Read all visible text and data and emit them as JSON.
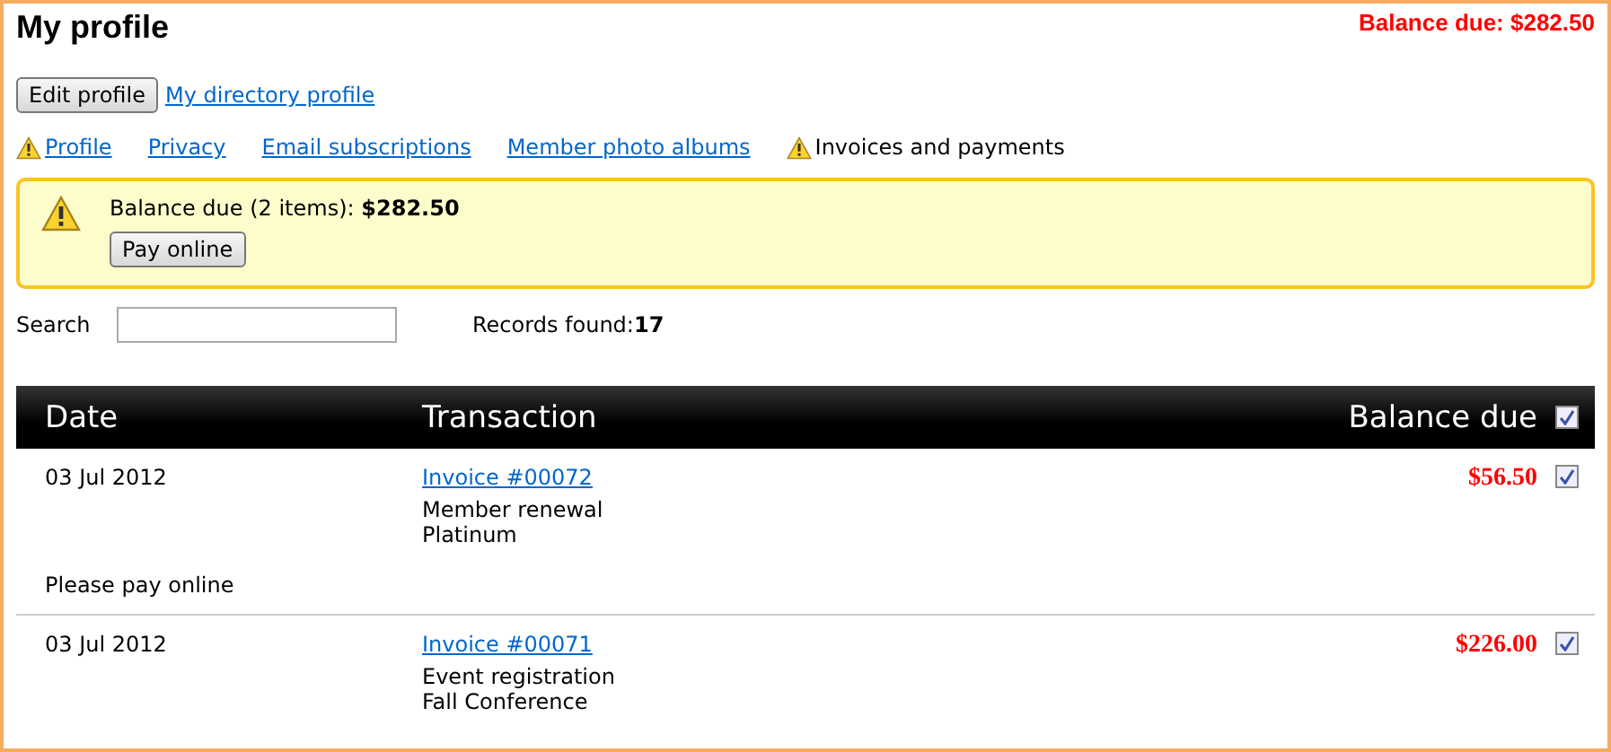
{
  "page": {
    "title": "My profile",
    "balance_summary": "Balance due: $282.50"
  },
  "actions": {
    "edit_button": "Edit profile",
    "directory_link": "My directory profile"
  },
  "tabs": [
    {
      "label": "Profile",
      "selected": false,
      "warning": true
    },
    {
      "label": "Privacy",
      "selected": false,
      "warning": false
    },
    {
      "label": "Email subscriptions",
      "selected": false,
      "warning": false
    },
    {
      "label": "Member photo albums",
      "selected": false,
      "warning": false
    },
    {
      "label": "Invoices and payments",
      "selected": true,
      "warning": true
    }
  ],
  "alert": {
    "text": "Balance due (2 items): **$282.50**",
    "button": "Pay online"
  },
  "search": {
    "label": "Search"
  },
  "records": {
    "label": "Records found:",
    "count": "17"
  },
  "table": {
    "columns": [
      "Date",
      "Transaction",
      "Balance due"
    ],
    "select_all_checked": true,
    "rows": [
      {
        "date": "03 Jul 2012",
        "invoice": "Invoice #00072",
        "lines": [
          "Member renewal",
          "Platinum"
        ],
        "amount": "$56.50",
        "checked": true,
        "note": "Please pay online"
      },
      {
        "date": "03 Jul 2012",
        "invoice": "Invoice #00071",
        "lines": [
          "Event registration",
          "Fall Conference"
        ],
        "amount": "$226.00",
        "checked": true
      }
    ]
  }
}
